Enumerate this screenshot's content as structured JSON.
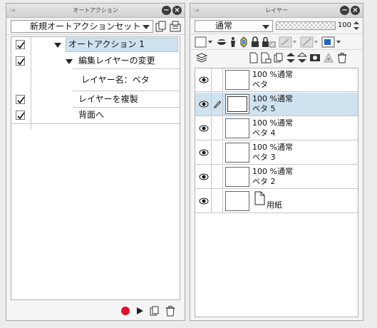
{
  "auto_action_panel": {
    "title": "オートアクション",
    "set_select_value": "新規オートアクションセット",
    "actions": [
      {
        "label": "オートアクション 1",
        "checked": true,
        "level": 0,
        "expanded": true,
        "selected": true
      },
      {
        "label": "編集レイヤーの変更",
        "checked": true,
        "level": 1,
        "expanded": true,
        "selected": false
      },
      {
        "label": "レイヤー名：ベタ",
        "checked": false,
        "level": 2,
        "expanded": false,
        "selected": false
      },
      {
        "label": "レイヤーを複製",
        "checked": true,
        "level": 1,
        "expanded": false,
        "selected": false
      },
      {
        "label": "背面へ",
        "checked": true,
        "level": 1,
        "expanded": false,
        "selected": false
      }
    ]
  },
  "layer_panel": {
    "title": "レイヤー",
    "blend_mode": "通常",
    "opacity": "100",
    "layers": [
      {
        "opacity_mode": "100 %通常",
        "name": "ベタ",
        "selected": false,
        "paper": false,
        "pen": false
      },
      {
        "opacity_mode": "100 %通常",
        "name": "ベタ 5",
        "selected": true,
        "paper": false,
        "pen": true
      },
      {
        "opacity_mode": "100 %通常",
        "name": "ベタ 4",
        "selected": false,
        "paper": false,
        "pen": false
      },
      {
        "opacity_mode": "100 %通常",
        "name": "ベタ 3",
        "selected": false,
        "paper": false,
        "pen": false
      },
      {
        "opacity_mode": "100 %通常",
        "name": "ベタ 2",
        "selected": false,
        "paper": false,
        "pen": false
      },
      {
        "opacity_mode": "",
        "name": "用紙",
        "selected": false,
        "paper": true,
        "pen": false
      }
    ]
  },
  "colors": {
    "selection": "#cfe2f0",
    "record_button": "#e0102a",
    "accent_blue": "#1e64c8"
  }
}
